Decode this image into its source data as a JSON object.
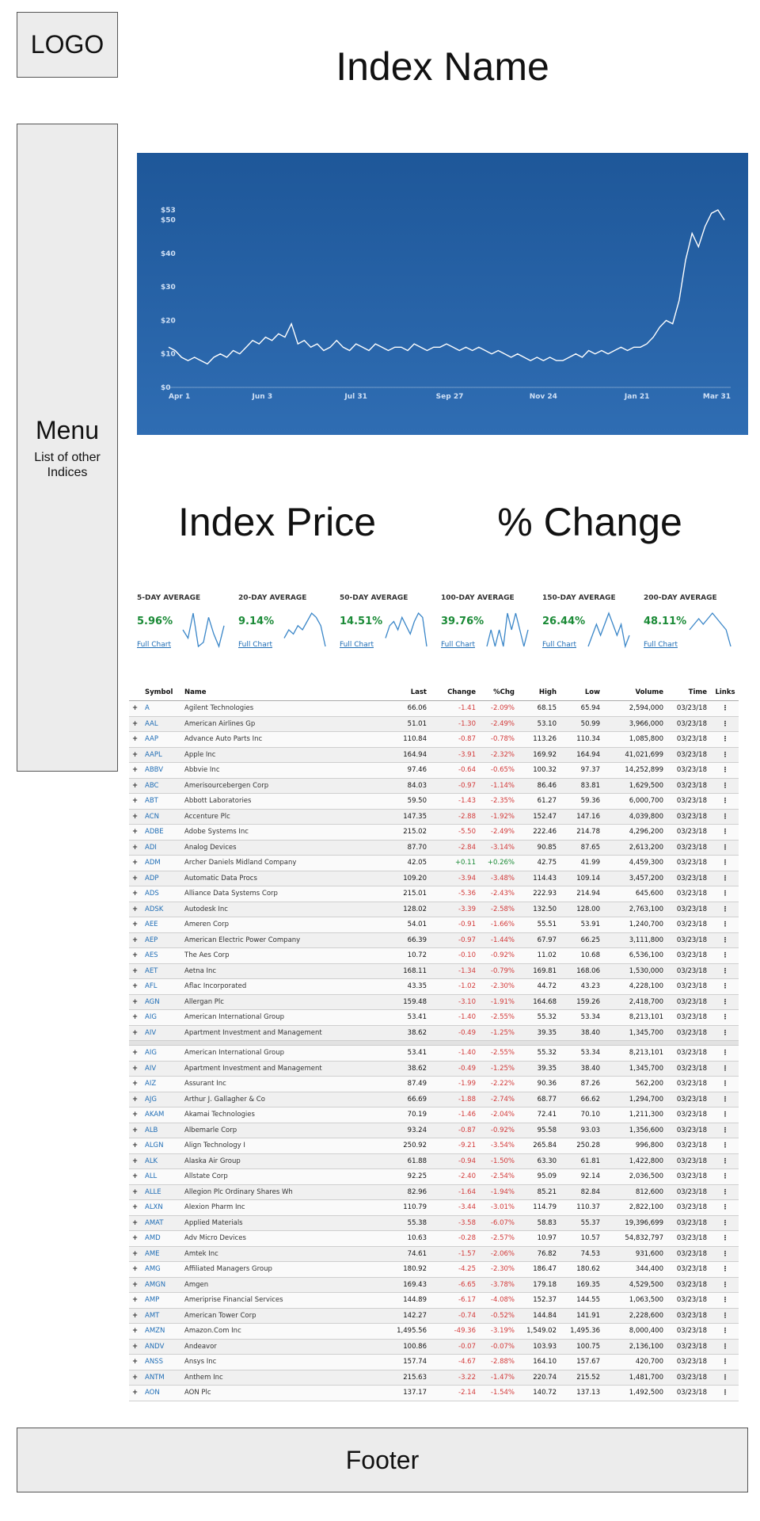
{
  "logo": "LOGO",
  "menu": {
    "title": "Menu",
    "subtitle": "List of other Indices"
  },
  "header": {
    "index_name": "Index Name"
  },
  "footer": "Footer",
  "price_labels": {
    "index_price": "Index Price",
    "pct_change": "% Change"
  },
  "chart_data": {
    "type": "line",
    "x_ticks": [
      "Apr 1",
      "Jun 3",
      "Jul 31",
      "Sep 27",
      "Nov 24",
      "Jan 21",
      "Mar 31"
    ],
    "y_ticks": [
      "$0",
      "$10",
      "$20",
      "$30",
      "$40",
      "$50",
      "$53"
    ],
    "ylim": [
      0,
      53
    ],
    "line_color": "#ffffff",
    "background": "#2563a6",
    "series": [
      {
        "values": [
          12,
          11,
          9,
          8,
          9,
          8,
          7,
          9,
          10,
          9,
          11,
          10,
          12,
          14,
          13,
          15,
          14,
          16,
          15,
          19,
          13,
          14,
          12,
          13,
          11,
          12,
          14,
          12,
          11,
          13,
          12,
          11,
          13,
          12,
          11,
          12,
          12,
          11,
          13,
          12,
          11,
          12,
          12,
          13,
          12,
          11,
          12,
          11,
          12,
          11,
          10,
          11,
          10,
          9,
          10,
          9,
          8,
          9,
          8,
          9,
          8,
          8,
          9,
          10,
          9,
          11,
          10,
          11,
          10,
          11,
          12,
          11,
          12,
          12,
          13,
          15,
          18,
          20,
          19,
          26,
          38,
          46,
          42,
          48,
          52,
          53,
          50
        ]
      }
    ]
  },
  "averages": [
    {
      "label": "5-DAY AVERAGE",
      "value": "5.96%",
      "link": "Full Chart",
      "spark": [
        5,
        3,
        9,
        1,
        2,
        8,
        4,
        1,
        6
      ]
    },
    {
      "label": "20-DAY AVERAGE",
      "value": "9.14%",
      "link": "Full Chart",
      "spark": [
        3,
        5,
        4,
        6,
        5,
        7,
        9,
        8,
        6,
        1
      ]
    },
    {
      "label": "50-DAY AVERAGE",
      "value": "14.51%",
      "link": "Full Chart",
      "spark": [
        3,
        6,
        7,
        5,
        8,
        6,
        4,
        7,
        9,
        8,
        1
      ]
    },
    {
      "label": "100-DAY AVERAGE",
      "value": "39.76%",
      "link": "Full Chart",
      "spark": [
        5,
        6,
        5,
        6,
        5,
        7,
        6,
        7,
        6,
        5,
        6
      ]
    },
    {
      "label": "150-DAY AVERAGE",
      "value": "26.44%",
      "link": "Full Chart",
      "spark": [
        4,
        5,
        6,
        5,
        6,
        7,
        6,
        5,
        6,
        4,
        5
      ]
    },
    {
      "label": "200-DAY AVERAGE",
      "value": "48.11%",
      "link": "Full Chart",
      "spark": [
        6,
        7,
        8,
        7,
        8,
        9,
        8,
        7,
        6,
        3
      ]
    }
  ],
  "table": {
    "headers": {
      "symbol": "Symbol",
      "name": "Name",
      "last": "Last",
      "change": "Change",
      "pct": "%Chg",
      "high": "High",
      "low": "Low",
      "volume": "Volume",
      "time": "Time",
      "links": "Links"
    },
    "rows": [
      [
        "A",
        "Agilent Technologies",
        "66.06",
        "-1.41",
        "-2.09%",
        "68.15",
        "65.94",
        "2,594,000",
        "03/23/18"
      ],
      [
        "AAL",
        "American Airlines Gp",
        "51.01",
        "-1.30",
        "-2.49%",
        "53.10",
        "50.99",
        "3,966,000",
        "03/23/18"
      ],
      [
        "AAP",
        "Advance Auto Parts Inc",
        "110.84",
        "-0.87",
        "-0.78%",
        "113.26",
        "110.34",
        "1,085,800",
        "03/23/18"
      ],
      [
        "AAPL",
        "Apple Inc",
        "164.94",
        "-3.91",
        "-2.32%",
        "169.92",
        "164.94",
        "41,021,699",
        "03/23/18"
      ],
      [
        "ABBV",
        "Abbvie Inc",
        "97.46",
        "-0.64",
        "-0.65%",
        "100.32",
        "97.37",
        "14,252,899",
        "03/23/18"
      ],
      [
        "ABC",
        "Amerisourcebergen Corp",
        "84.03",
        "-0.97",
        "-1.14%",
        "86.46",
        "83.81",
        "1,629,500",
        "03/23/18"
      ],
      [
        "ABT",
        "Abbott Laboratories",
        "59.50",
        "-1.43",
        "-2.35%",
        "61.27",
        "59.36",
        "6,000,700",
        "03/23/18"
      ],
      [
        "ACN",
        "Accenture Plc",
        "147.35",
        "-2.88",
        "-1.92%",
        "152.47",
        "147.16",
        "4,039,800",
        "03/23/18"
      ],
      [
        "ADBE",
        "Adobe Systems Inc",
        "215.02",
        "-5.50",
        "-2.49%",
        "222.46",
        "214.78",
        "4,296,200",
        "03/23/18"
      ],
      [
        "ADI",
        "Analog Devices",
        "87.70",
        "-2.84",
        "-3.14%",
        "90.85",
        "87.65",
        "2,613,200",
        "03/23/18"
      ],
      [
        "ADM",
        "Archer Daniels Midland Company",
        "42.05",
        "+0.11",
        "+0.26%",
        "42.75",
        "41.99",
        "4,459,300",
        "03/23/18"
      ],
      [
        "ADP",
        "Automatic Data Procs",
        "109.20",
        "-3.94",
        "-3.48%",
        "114.43",
        "109.14",
        "3,457,200",
        "03/23/18"
      ],
      [
        "ADS",
        "Alliance Data Systems Corp",
        "215.01",
        "-5.36",
        "-2.43%",
        "222.93",
        "214.94",
        "645,600",
        "03/23/18"
      ],
      [
        "ADSK",
        "Autodesk Inc",
        "128.02",
        "-3.39",
        "-2.58%",
        "132.50",
        "128.00",
        "2,763,100",
        "03/23/18"
      ],
      [
        "AEE",
        "Ameren Corp",
        "54.01",
        "-0.91",
        "-1.66%",
        "55.51",
        "53.91",
        "1,240,700",
        "03/23/18"
      ],
      [
        "AEP",
        "American Electric Power Company",
        "66.39",
        "-0.97",
        "-1.44%",
        "67.97",
        "66.25",
        "3,111,800",
        "03/23/18"
      ],
      [
        "AES",
        "The Aes Corp",
        "10.72",
        "-0.10",
        "-0.92%",
        "11.02",
        "10.68",
        "6,536,100",
        "03/23/18"
      ],
      [
        "AET",
        "Aetna Inc",
        "168.11",
        "-1.34",
        "-0.79%",
        "169.81",
        "168.06",
        "1,530,000",
        "03/23/18"
      ],
      [
        "AFL",
        "Aflac Incorporated",
        "43.35",
        "-1.02",
        "-2.30%",
        "44.72",
        "43.23",
        "4,228,100",
        "03/23/18"
      ],
      [
        "AGN",
        "Allergan Plc",
        "159.48",
        "-3.10",
        "-1.91%",
        "164.68",
        "159.26",
        "2,418,700",
        "03/23/18"
      ],
      [
        "AIG",
        "American International Group",
        "53.41",
        "-1.40",
        "-2.55%",
        "55.32",
        "53.34",
        "8,213,101",
        "03/23/18"
      ],
      [
        "AIV",
        "Apartment Investment and Management",
        "38.62",
        "-0.49",
        "-1.25%",
        "39.35",
        "38.40",
        "1,345,700",
        "03/23/18"
      ]
    ],
    "rows2": [
      [
        "AIG",
        "American International Group",
        "53.41",
        "-1.40",
        "-2.55%",
        "55.32",
        "53.34",
        "8,213,101",
        "03/23/18"
      ],
      [
        "AIV",
        "Apartment Investment and Management",
        "38.62",
        "-0.49",
        "-1.25%",
        "39.35",
        "38.40",
        "1,345,700",
        "03/23/18"
      ],
      [
        "AIZ",
        "Assurant Inc",
        "87.49",
        "-1.99",
        "-2.22%",
        "90.36",
        "87.26",
        "562,200",
        "03/23/18"
      ],
      [
        "AJG",
        "Arthur J. Gallagher & Co",
        "66.69",
        "-1.88",
        "-2.74%",
        "68.77",
        "66.62",
        "1,294,700",
        "03/23/18"
      ],
      [
        "AKAM",
        "Akamai Technologies",
        "70.19",
        "-1.46",
        "-2.04%",
        "72.41",
        "70.10",
        "1,211,300",
        "03/23/18"
      ],
      [
        "ALB",
        "Albemarle Corp",
        "93.24",
        "-0.87",
        "-0.92%",
        "95.58",
        "93.03",
        "1,356,600",
        "03/23/18"
      ],
      [
        "ALGN",
        "Align Technology I",
        "250.92",
        "-9.21",
        "-3.54%",
        "265.84",
        "250.28",
        "996,800",
        "03/23/18"
      ],
      [
        "ALK",
        "Alaska Air Group",
        "61.88",
        "-0.94",
        "-1.50%",
        "63.30",
        "61.81",
        "1,422,800",
        "03/23/18"
      ],
      [
        "ALL",
        "Allstate Corp",
        "92.25",
        "-2.40",
        "-2.54%",
        "95.09",
        "92.14",
        "2,036,500",
        "03/23/18"
      ],
      [
        "ALLE",
        "Allegion Plc Ordinary Shares Wh",
        "82.96",
        "-1.64",
        "-1.94%",
        "85.21",
        "82.84",
        "812,600",
        "03/23/18"
      ],
      [
        "ALXN",
        "Alexion Pharm Inc",
        "110.79",
        "-3.44",
        "-3.01%",
        "114.79",
        "110.37",
        "2,822,100",
        "03/23/18"
      ],
      [
        "AMAT",
        "Applied Materials",
        "55.38",
        "-3.58",
        "-6.07%",
        "58.83",
        "55.37",
        "19,396,699",
        "03/23/18"
      ],
      [
        "AMD",
        "Adv Micro Devices",
        "10.63",
        "-0.28",
        "-2.57%",
        "10.97",
        "10.57",
        "54,832,797",
        "03/23/18"
      ],
      [
        "AME",
        "Amtek Inc",
        "74.61",
        "-1.57",
        "-2.06%",
        "76.82",
        "74.53",
        "931,600",
        "03/23/18"
      ],
      [
        "AMG",
        "Affiliated Managers Group",
        "180.92",
        "-4.25",
        "-2.30%",
        "186.47",
        "180.62",
        "344,400",
        "03/23/18"
      ],
      [
        "AMGN",
        "Amgen",
        "169.43",
        "-6.65",
        "-3.78%",
        "179.18",
        "169.35",
        "4,529,500",
        "03/23/18"
      ],
      [
        "AMP",
        "Ameriprise Financial Services",
        "144.89",
        "-6.17",
        "-4.08%",
        "152.37",
        "144.55",
        "1,063,500",
        "03/23/18"
      ],
      [
        "AMT",
        "American Tower Corp",
        "142.27",
        "-0.74",
        "-0.52%",
        "144.84",
        "141.91",
        "2,228,600",
        "03/23/18"
      ],
      [
        "AMZN",
        "Amazon.Com Inc",
        "1,495.56",
        "-49.36",
        "-3.19%",
        "1,549.02",
        "1,495.36",
        "8,000,400",
        "03/23/18"
      ],
      [
        "ANDV",
        "Andeavor",
        "100.86",
        "-0.07",
        "-0.07%",
        "103.93",
        "100.75",
        "2,136,100",
        "03/23/18"
      ],
      [
        "ANSS",
        "Ansys Inc",
        "157.74",
        "-4.67",
        "-2.88%",
        "164.10",
        "157.67",
        "420,700",
        "03/23/18"
      ],
      [
        "ANTM",
        "Anthem Inc",
        "215.63",
        "-3.22",
        "-1.47%",
        "220.74",
        "215.52",
        "1,481,700",
        "03/23/18"
      ],
      [
        "AON",
        "AON Plc",
        "137.17",
        "-2.14",
        "-1.54%",
        "140.72",
        "137.13",
        "1,492,500",
        "03/23/18"
      ]
    ],
    "plus_icon": "+",
    "links_icon": "⋮"
  }
}
